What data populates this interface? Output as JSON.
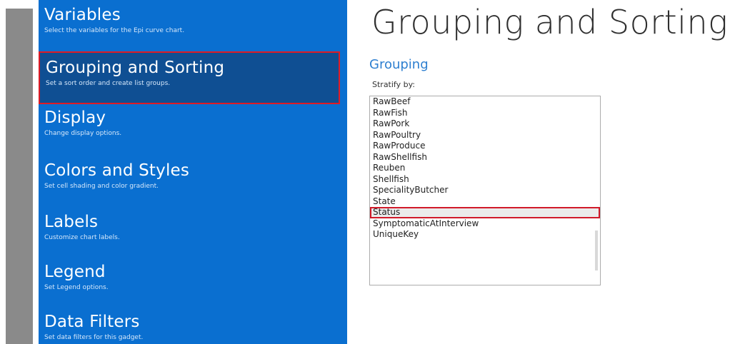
{
  "sidebar": {
    "items": [
      {
        "title": "Variables",
        "desc": "Select the variables for the Epi curve chart."
      },
      {
        "title": "Grouping and Sorting",
        "desc": "Set a sort order and create list groups."
      },
      {
        "title": "Display",
        "desc": "Change display options."
      },
      {
        "title": "Colors and Styles",
        "desc": "Set cell shading and color gradient."
      },
      {
        "title": "Labels",
        "desc": "Customize chart labels."
      },
      {
        "title": "Legend",
        "desc": "Set Legend options."
      },
      {
        "title": "Data Filters",
        "desc": "Set data filters for this gadget."
      }
    ],
    "selected": "Grouping and Sorting"
  },
  "main": {
    "title": "Grouping and Sorting",
    "section": "Grouping",
    "stratify_label": "Stratify by:",
    "list": [
      "RawBeef",
      "RawFish",
      "RawPork",
      "RawPoultry",
      "RawProduce",
      "RawShellfish",
      "Reuben",
      "Shellfish",
      "SpecialityButcher",
      "State",
      "Status",
      "SymptomaticAtInterview",
      "UniqueKey"
    ],
    "highlighted": "Status"
  }
}
